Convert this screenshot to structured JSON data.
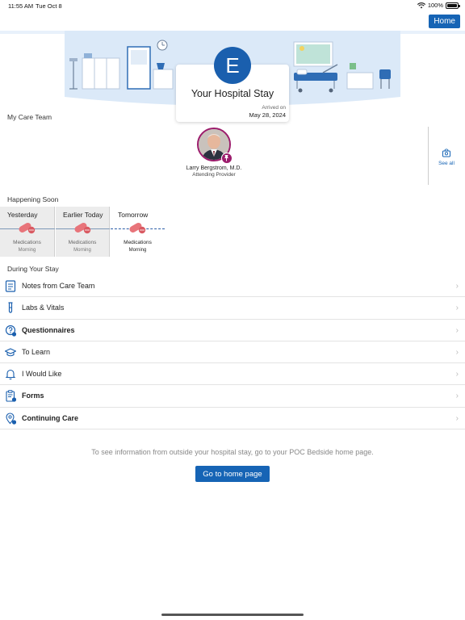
{
  "status": {
    "time": "11:55 AM",
    "date": "Tue Oct 8",
    "battery": "100%"
  },
  "header": {
    "home_label": "Home"
  },
  "stay": {
    "initial": "E",
    "title": "Your Hospital Stay",
    "arrived_label": "Arrived on",
    "arrived_date": "May 28, 2024"
  },
  "care_team": {
    "section_label": "My Care Team",
    "provider_name": "Larry Bergstrom, M.D.",
    "provider_role": "Attending Provider",
    "see_all_label": "See all"
  },
  "happening_soon": {
    "section_label": "Happening Soon",
    "columns": [
      {
        "label": "Yesterday",
        "item": "Medications",
        "time": "Morning"
      },
      {
        "label": "Earlier Today",
        "item": "Medications",
        "time": "Morning"
      },
      {
        "label": "Tomorrow",
        "item": "Medications",
        "time": "Morning"
      }
    ]
  },
  "during_stay": {
    "section_label": "During Your Stay",
    "items": [
      {
        "label": "Notes from Care Team",
        "icon": "notes-icon"
      },
      {
        "label": "Labs & Vitals",
        "icon": "test-tube-icon"
      },
      {
        "label": "Questionnaires",
        "icon": "question-icon"
      },
      {
        "label": "To Learn",
        "icon": "graduation-cap-icon"
      },
      {
        "label": "I Would Like",
        "icon": "bell-icon"
      },
      {
        "label": "Forms",
        "icon": "clipboard-icon"
      },
      {
        "label": "Continuing Care",
        "icon": "location-pin-icon"
      }
    ]
  },
  "footer": {
    "info": "To see information from outside your hospital stay, go to your POC Bedside home page.",
    "button_label": "Go to home page"
  },
  "colors": {
    "accent": "#1664b5",
    "banner": "#dbe9f8",
    "provider_ring": "#9c1c6c",
    "pill": "#e8747a"
  }
}
